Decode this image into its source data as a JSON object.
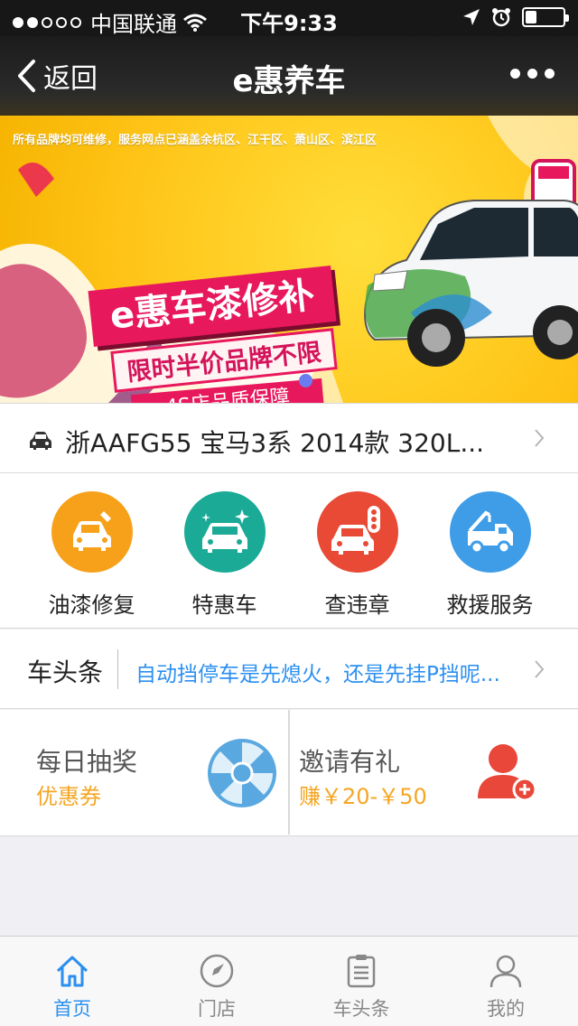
{
  "status_bar": {
    "carrier": "中国联通",
    "time": "下午9:33",
    "battery_level": 0.3
  },
  "nav": {
    "back_label": "返回",
    "title": "e惠养车",
    "more_icon": "more-dots-icon"
  },
  "banner": {
    "caption": "所有品牌均可维修，服务网点已涵盖余杭区、江干区、萧山区、滨江区",
    "title": "e惠车漆修补",
    "subtitle": "限时半价品牌不限",
    "badge": "4S店品质保障",
    "slide_index": 1
  },
  "car": {
    "icon": "car-icon",
    "text": "浙AAFG55 宝马3系 2014款 320L..."
  },
  "services": [
    {
      "label": "油漆修复",
      "icon": "paint-car-icon",
      "color": "#f7a11a"
    },
    {
      "label": "特惠车",
      "icon": "sparkle-car-icon",
      "color": "#1aaa96"
    },
    {
      "label": "查违章",
      "icon": "traffic-light-car-icon",
      "color": "#e84a35"
    },
    {
      "label": "救援服务",
      "icon": "tow-truck-icon",
      "color": "#3f9de8"
    }
  ],
  "headline": {
    "tag": "车头条",
    "text": "自动挡停车是先熄火，还是先挂P挡呢..."
  },
  "promos": [
    {
      "title": "每日抽奖",
      "subtitle": "优惠券",
      "icon": "lucky-wheel-icon"
    },
    {
      "title": "邀请有礼",
      "subtitle": "赚￥20-￥50",
      "icon": "invite-user-icon"
    }
  ],
  "tabs": [
    {
      "label": "首页",
      "icon": "home-icon",
      "active": true
    },
    {
      "label": "门店",
      "icon": "compass-icon",
      "active": false
    },
    {
      "label": "车头条",
      "icon": "clipboard-icon",
      "active": false
    },
    {
      "label": "我的",
      "icon": "user-icon",
      "active": false
    }
  ],
  "colors": {
    "accent_blue": "#2b8ff0",
    "promo_orange": "#f5a623",
    "banner_pink": "#e8185d",
    "banner_yellow": "#ffc61a"
  }
}
